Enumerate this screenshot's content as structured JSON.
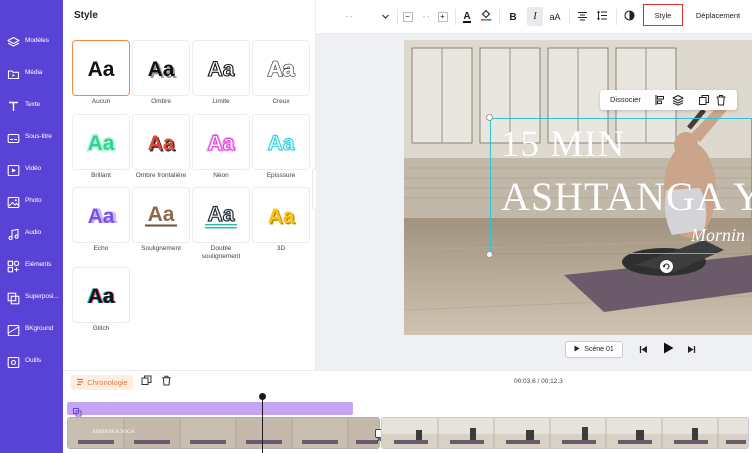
{
  "sidebar": {
    "items": [
      {
        "label": "Modèles",
        "icon": "layers-icon"
      },
      {
        "label": "Média",
        "icon": "folder-icon"
      },
      {
        "label": "Texte",
        "icon": "text-icon"
      },
      {
        "label": "Sous-titre",
        "icon": "subtitle-icon"
      },
      {
        "label": "Vidéo",
        "icon": "video-icon"
      },
      {
        "label": "Photo",
        "icon": "image-icon"
      },
      {
        "label": "Audio",
        "icon": "music-icon"
      },
      {
        "label": "Eléments",
        "icon": "shapes-icon"
      },
      {
        "label": "Superposi...",
        "icon": "overlay-icon"
      },
      {
        "label": "BKground",
        "icon": "background-icon"
      },
      {
        "label": "Outils",
        "icon": "tools-icon"
      }
    ]
  },
  "panel": {
    "title": "Style",
    "styles": [
      {
        "label": "Aucun",
        "glyph": "Aa",
        "selected": true
      },
      {
        "label": "Ombre",
        "glyph": "Aa"
      },
      {
        "label": "Limite",
        "glyph": "Aa"
      },
      {
        "label": "Creux",
        "glyph": "Aa"
      },
      {
        "label": "Brillant",
        "glyph": "Aa"
      },
      {
        "label": "Ombre frontalière",
        "glyph": "Aa"
      },
      {
        "label": "Néon",
        "glyph": "Aa"
      },
      {
        "label": "Episssure",
        "glyph": "Aa"
      },
      {
        "label": "Echo",
        "glyph": "Aa"
      },
      {
        "label": "Soulignement",
        "glyph": "Aa"
      },
      {
        "label": "Double soulignement",
        "glyph": "Aa"
      },
      {
        "label": "3D",
        "glyph": "Aa"
      },
      {
        "label": "Glitch",
        "glyph": "Aa"
      }
    ]
  },
  "toolbar": {
    "font_value": "- -",
    "size_value": "- -",
    "minus": "−",
    "plus": "+",
    "text_color_glyph": "A",
    "bold": "B",
    "italic": "I",
    "case": "aA",
    "style_tab": "Style",
    "move_tab": "Déplacement"
  },
  "canvas": {
    "float_toolbar": {
      "dissocier": "Dissocier"
    },
    "title_line1": "15 MIN",
    "title_line2": "ASHTANGA YO",
    "subtitle": "Mornin",
    "scene_label": "Scène 01"
  },
  "timeline": {
    "chronologie": "Chronologie",
    "timecode": "00:03.6 / 00:12.3",
    "clip_thumb_text": "ASHTANGA YOGA"
  },
  "colors": {
    "sidebar": "#5943d6",
    "accent_orange": "#e3783b",
    "selection": "#2ec3d6",
    "style_tab_border": "#e03030",
    "purple_track": "#c4a4f3"
  }
}
